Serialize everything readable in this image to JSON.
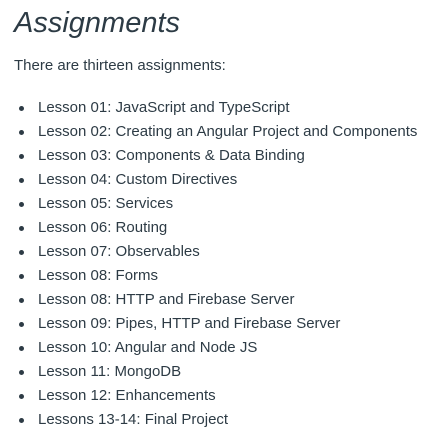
{
  "page": {
    "title": "Assignments",
    "intro": "There are thirteen assignments:"
  },
  "assignments": [
    "Lesson 01: JavaScript and TypeScript",
    "Lesson 02: Creating an Angular Project and Components",
    "Lesson 03: Components & Data Binding",
    "Lesson 04: Custom Directives",
    "Lesson 05: Services",
    "Lesson 06: Routing",
    "Lesson 07: Observables",
    "Lesson 08: Forms",
    "Lesson 08: HTTP and Firebase Server",
    "Lesson 09: Pipes, HTTP and Firebase Server",
    "Lesson 10: Angular and Node JS",
    "Lesson 11: MongoDB",
    "Lesson 12: Enhancements",
    "Lessons 13-14: Final Project"
  ]
}
